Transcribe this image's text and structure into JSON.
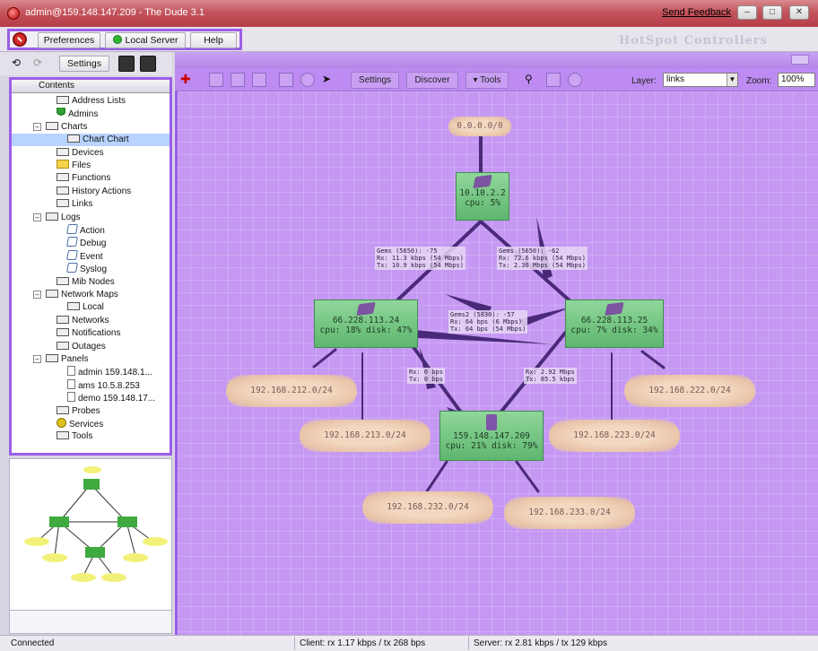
{
  "window": {
    "title": "admin@159.148.147.209 - The Dude 3.1",
    "send_feedback": "Send Feedback",
    "btn_minimize": "–",
    "btn_maximize": "□",
    "btn_close": "✕"
  },
  "menubar": {
    "preferences": "Preferences",
    "local_server": "Local Server",
    "help": "Help",
    "brand": "HotSpot Controllers"
  },
  "toolbar": {
    "settings": "Settings"
  },
  "tree": {
    "header": "Contents",
    "items": [
      {
        "label": "Address Lists",
        "icon": "list-icon",
        "level": 1
      },
      {
        "label": "Admins",
        "icon": "admin-icon",
        "level": 1
      },
      {
        "label": "Charts",
        "icon": "folder-icon",
        "level": 0,
        "expand": "–"
      },
      {
        "label": "Chart Chart",
        "icon": "chart-icon",
        "level": 2,
        "selected": true
      },
      {
        "label": "Devices",
        "icon": "devices-icon",
        "level": 1
      },
      {
        "label": "Files",
        "icon": "files-icon",
        "level": 1
      },
      {
        "label": "Functions",
        "icon": "functions-icon",
        "level": 1
      },
      {
        "label": "History Actions",
        "icon": "history-icon",
        "level": 1
      },
      {
        "label": "Links",
        "icon": "links-icon",
        "level": 1
      },
      {
        "label": "Logs",
        "icon": "logs-icon",
        "level": 0,
        "expand": "–"
      },
      {
        "label": "Action",
        "icon": "log-icon",
        "level": 2
      },
      {
        "label": "Debug",
        "icon": "log-icon",
        "level": 2
      },
      {
        "label": "Event",
        "icon": "log-icon",
        "level": 2
      },
      {
        "label": "Syslog",
        "icon": "log-icon",
        "level": 2
      },
      {
        "label": "Mib Nodes",
        "icon": "mib-icon",
        "level": 1
      },
      {
        "label": "Network Maps",
        "icon": "map-icon",
        "level": 0,
        "expand": "–"
      },
      {
        "label": "Local",
        "icon": "map-icon",
        "level": 2
      },
      {
        "label": "Networks",
        "icon": "networks-icon",
        "level": 1
      },
      {
        "label": "Notifications",
        "icon": "notifications-icon",
        "level": 1
      },
      {
        "label": "Outages",
        "icon": "outages-icon",
        "level": 1
      },
      {
        "label": "Panels",
        "icon": "panels-icon",
        "level": 0,
        "expand": "–"
      },
      {
        "label": "admin 159.148.1...",
        "icon": "panel-icon",
        "level": 2
      },
      {
        "label": "ams 10.5.8.253",
        "icon": "panel-icon",
        "level": 2
      },
      {
        "label": "demo 159.148.17...",
        "icon": "panel-icon",
        "level": 2
      },
      {
        "label": "Probes",
        "icon": "probes-icon",
        "level": 1
      },
      {
        "label": "Services",
        "icon": "services-icon",
        "level": 1
      },
      {
        "label": "Tools",
        "icon": "tools-icon",
        "level": 1
      }
    ]
  },
  "map_toolbar": {
    "settings": "Settings",
    "discover": "Discover",
    "tools": "▾ Tools",
    "layer_label": "Layer:",
    "layer_value": "links",
    "zoom_label": "Zoom:",
    "zoom_value": "100%"
  },
  "map": {
    "devices": [
      {
        "id": "core",
        "ip": "10.10.2.2",
        "stats": "cpu: 5%"
      },
      {
        "id": "left",
        "ip": "66.228.113.24",
        "stats": "cpu: 18% disk: 47%"
      },
      {
        "id": "right",
        "ip": "66.228.113.25",
        "stats": "cpu: 7% disk: 34%"
      },
      {
        "id": "server",
        "ip": "159.148.147.209",
        "stats": "cpu: 21% disk: 79%"
      }
    ],
    "clouds": [
      {
        "id": "top",
        "label": "0.0.0.0/0"
      },
      {
        "id": "c212",
        "label": "192.168.212.0/24"
      },
      {
        "id": "c213",
        "label": "192.168.213.0/24"
      },
      {
        "id": "c222",
        "label": "192.168.222.0/24"
      },
      {
        "id": "c223",
        "label": "192.168.223.0/24"
      },
      {
        "id": "c232",
        "label": "192.168.232.0/24"
      },
      {
        "id": "c233",
        "label": "192.168.233.0/24"
      }
    ],
    "link_labels": [
      {
        "id": "l1",
        "text": "Gems (5650): -75\nRx: 11.3 kbps (54 Mbps)\nTx: 10.9 kbps (54 Mbps)"
      },
      {
        "id": "l2",
        "text": "Gems (5650): -62\nRx: 72.6 kbps (54 Mbps)\nTx: 2.36 Mbps (54 Mbps)"
      },
      {
        "id": "l3",
        "text": "Gems2 (5830): -57\nRx: 64 bps (6 Mbps)\nTx: 64 bps (54 Mbps)"
      },
      {
        "id": "l4",
        "text": "Rx: 0 bps\nTx: 0 bps"
      },
      {
        "id": "l5",
        "text": "Rx: 2.92 Mbps\nTx: 85.5 kbps"
      }
    ]
  },
  "statusbar": {
    "connection": "Connected",
    "client": "Client: rx 1.17 kbps / tx 268 bps",
    "server": "Server: rx 2.81 kbps / tx 129 kbps"
  },
  "colors": {
    "accent_highlight": "#9b5ee8",
    "map_background": "#c598f3",
    "device_fill": "#7fcf8c",
    "cloud_fill": "#f3d8c1",
    "link_color": "#4a2a78"
  }
}
